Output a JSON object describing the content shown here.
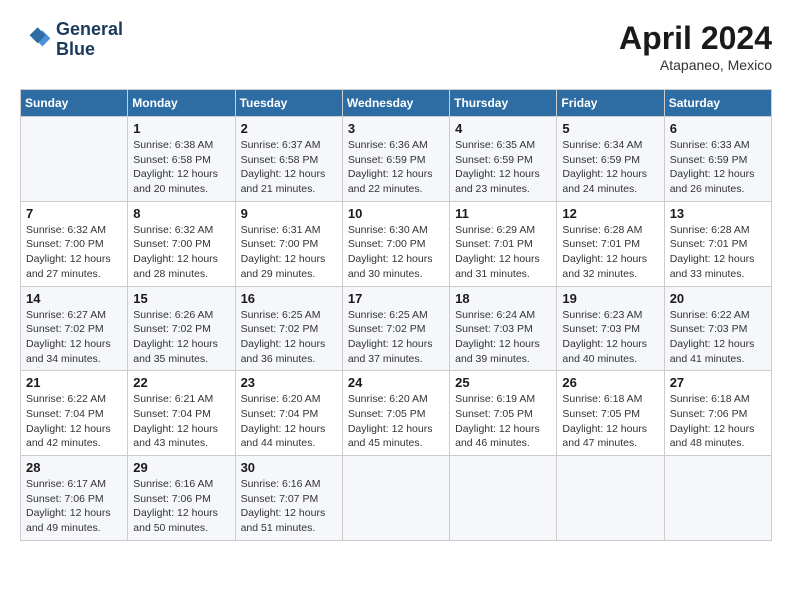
{
  "header": {
    "logo_line1": "General",
    "logo_line2": "Blue",
    "month_title": "April 2024",
    "location": "Atapaneo, Mexico"
  },
  "calendar": {
    "days_of_week": [
      "Sunday",
      "Monday",
      "Tuesday",
      "Wednesday",
      "Thursday",
      "Friday",
      "Saturday"
    ],
    "weeks": [
      [
        {
          "day": "",
          "sunrise": "",
          "sunset": "",
          "daylight": ""
        },
        {
          "day": "1",
          "sunrise": "Sunrise: 6:38 AM",
          "sunset": "Sunset: 6:58 PM",
          "daylight": "Daylight: 12 hours and 20 minutes."
        },
        {
          "day": "2",
          "sunrise": "Sunrise: 6:37 AM",
          "sunset": "Sunset: 6:58 PM",
          "daylight": "Daylight: 12 hours and 21 minutes."
        },
        {
          "day": "3",
          "sunrise": "Sunrise: 6:36 AM",
          "sunset": "Sunset: 6:59 PM",
          "daylight": "Daylight: 12 hours and 22 minutes."
        },
        {
          "day": "4",
          "sunrise": "Sunrise: 6:35 AM",
          "sunset": "Sunset: 6:59 PM",
          "daylight": "Daylight: 12 hours and 23 minutes."
        },
        {
          "day": "5",
          "sunrise": "Sunrise: 6:34 AM",
          "sunset": "Sunset: 6:59 PM",
          "daylight": "Daylight: 12 hours and 24 minutes."
        },
        {
          "day": "6",
          "sunrise": "Sunrise: 6:33 AM",
          "sunset": "Sunset: 6:59 PM",
          "daylight": "Daylight: 12 hours and 26 minutes."
        }
      ],
      [
        {
          "day": "7",
          "sunrise": "Sunrise: 6:32 AM",
          "sunset": "Sunset: 7:00 PM",
          "daylight": "Daylight: 12 hours and 27 minutes."
        },
        {
          "day": "8",
          "sunrise": "Sunrise: 6:32 AM",
          "sunset": "Sunset: 7:00 PM",
          "daylight": "Daylight: 12 hours and 28 minutes."
        },
        {
          "day": "9",
          "sunrise": "Sunrise: 6:31 AM",
          "sunset": "Sunset: 7:00 PM",
          "daylight": "Daylight: 12 hours and 29 minutes."
        },
        {
          "day": "10",
          "sunrise": "Sunrise: 6:30 AM",
          "sunset": "Sunset: 7:00 PM",
          "daylight": "Daylight: 12 hours and 30 minutes."
        },
        {
          "day": "11",
          "sunrise": "Sunrise: 6:29 AM",
          "sunset": "Sunset: 7:01 PM",
          "daylight": "Daylight: 12 hours and 31 minutes."
        },
        {
          "day": "12",
          "sunrise": "Sunrise: 6:28 AM",
          "sunset": "Sunset: 7:01 PM",
          "daylight": "Daylight: 12 hours and 32 minutes."
        },
        {
          "day": "13",
          "sunrise": "Sunrise: 6:28 AM",
          "sunset": "Sunset: 7:01 PM",
          "daylight": "Daylight: 12 hours and 33 minutes."
        }
      ],
      [
        {
          "day": "14",
          "sunrise": "Sunrise: 6:27 AM",
          "sunset": "Sunset: 7:02 PM",
          "daylight": "Daylight: 12 hours and 34 minutes."
        },
        {
          "day": "15",
          "sunrise": "Sunrise: 6:26 AM",
          "sunset": "Sunset: 7:02 PM",
          "daylight": "Daylight: 12 hours and 35 minutes."
        },
        {
          "day": "16",
          "sunrise": "Sunrise: 6:25 AM",
          "sunset": "Sunset: 7:02 PM",
          "daylight": "Daylight: 12 hours and 36 minutes."
        },
        {
          "day": "17",
          "sunrise": "Sunrise: 6:25 AM",
          "sunset": "Sunset: 7:02 PM",
          "daylight": "Daylight: 12 hours and 37 minutes."
        },
        {
          "day": "18",
          "sunrise": "Sunrise: 6:24 AM",
          "sunset": "Sunset: 7:03 PM",
          "daylight": "Daylight: 12 hours and 39 minutes."
        },
        {
          "day": "19",
          "sunrise": "Sunrise: 6:23 AM",
          "sunset": "Sunset: 7:03 PM",
          "daylight": "Daylight: 12 hours and 40 minutes."
        },
        {
          "day": "20",
          "sunrise": "Sunrise: 6:22 AM",
          "sunset": "Sunset: 7:03 PM",
          "daylight": "Daylight: 12 hours and 41 minutes."
        }
      ],
      [
        {
          "day": "21",
          "sunrise": "Sunrise: 6:22 AM",
          "sunset": "Sunset: 7:04 PM",
          "daylight": "Daylight: 12 hours and 42 minutes."
        },
        {
          "day": "22",
          "sunrise": "Sunrise: 6:21 AM",
          "sunset": "Sunset: 7:04 PM",
          "daylight": "Daylight: 12 hours and 43 minutes."
        },
        {
          "day": "23",
          "sunrise": "Sunrise: 6:20 AM",
          "sunset": "Sunset: 7:04 PM",
          "daylight": "Daylight: 12 hours and 44 minutes."
        },
        {
          "day": "24",
          "sunrise": "Sunrise: 6:20 AM",
          "sunset": "Sunset: 7:05 PM",
          "daylight": "Daylight: 12 hours and 45 minutes."
        },
        {
          "day": "25",
          "sunrise": "Sunrise: 6:19 AM",
          "sunset": "Sunset: 7:05 PM",
          "daylight": "Daylight: 12 hours and 46 minutes."
        },
        {
          "day": "26",
          "sunrise": "Sunrise: 6:18 AM",
          "sunset": "Sunset: 7:05 PM",
          "daylight": "Daylight: 12 hours and 47 minutes."
        },
        {
          "day": "27",
          "sunrise": "Sunrise: 6:18 AM",
          "sunset": "Sunset: 7:06 PM",
          "daylight": "Daylight: 12 hours and 48 minutes."
        }
      ],
      [
        {
          "day": "28",
          "sunrise": "Sunrise: 6:17 AM",
          "sunset": "Sunset: 7:06 PM",
          "daylight": "Daylight: 12 hours and 49 minutes."
        },
        {
          "day": "29",
          "sunrise": "Sunrise: 6:16 AM",
          "sunset": "Sunset: 7:06 PM",
          "daylight": "Daylight: 12 hours and 50 minutes."
        },
        {
          "day": "30",
          "sunrise": "Sunrise: 6:16 AM",
          "sunset": "Sunset: 7:07 PM",
          "daylight": "Daylight: 12 hours and 51 minutes."
        },
        {
          "day": "",
          "sunrise": "",
          "sunset": "",
          "daylight": ""
        },
        {
          "day": "",
          "sunrise": "",
          "sunset": "",
          "daylight": ""
        },
        {
          "day": "",
          "sunrise": "",
          "sunset": "",
          "daylight": ""
        },
        {
          "day": "",
          "sunrise": "",
          "sunset": "",
          "daylight": ""
        }
      ]
    ]
  }
}
